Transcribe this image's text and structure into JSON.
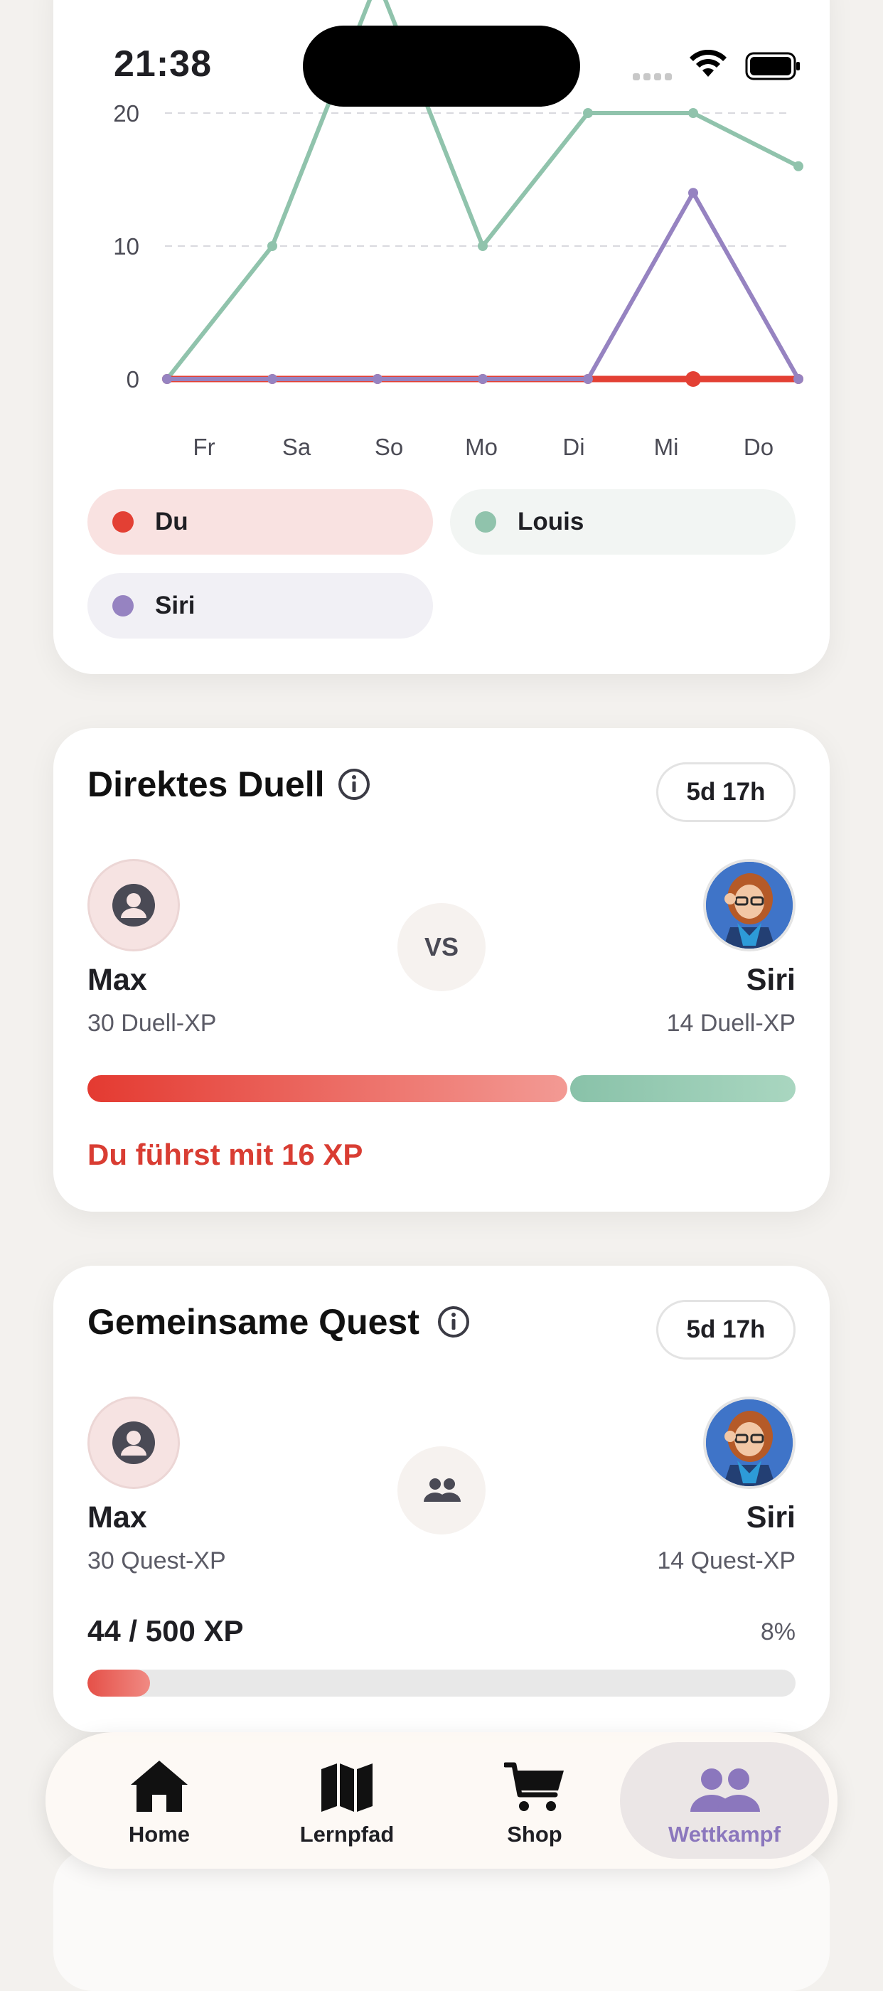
{
  "status_bar": {
    "time": "21:38"
  },
  "chart_card": {
    "chart_data": {
      "type": "line",
      "categories": [
        "Fr",
        "Sa",
        "So",
        "Mo",
        "Di",
        "Mi",
        "Do"
      ],
      "y_ticks": [
        "0",
        "10",
        "20"
      ],
      "ylim": [
        0,
        20
      ],
      "grid": true,
      "series": [
        {
          "name": "Du",
          "color": "#e34034",
          "values": [
            0,
            0,
            0,
            0,
            0,
            0,
            0
          ],
          "x_offsets": [
            0,
            1,
            2,
            3,
            4,
            5,
            6
          ]
        },
        {
          "name": "Louis",
          "color": "#90c3ac",
          "values": [
            0,
            10,
            30,
            10,
            20,
            20,
            16
          ]
        },
        {
          "name": "Siri",
          "color": "#9683c1",
          "values": [
            0,
            0,
            0,
            0,
            0,
            14,
            0
          ]
        }
      ]
    },
    "legend": [
      {
        "label": "Du",
        "color": "#e34034",
        "bg": "#f9e2e1"
      },
      {
        "label": "Louis",
        "color": "#90c3ac",
        "bg": "#f2f5f3"
      },
      {
        "label": "Siri",
        "color": "#9683c1",
        "bg": "#f1f0f5"
      }
    ]
  },
  "duel": {
    "title": "Direktes Duell",
    "timer": "5d 17h",
    "vs_label": "VS",
    "left": {
      "name": "Max",
      "xp": "30 Duell-XP"
    },
    "right": {
      "name": "Siri",
      "xp": "14 Duell-XP"
    },
    "lead_text": "Du führst mit 16 XP",
    "share_left": 0.68
  },
  "quest": {
    "title": "Gemeinsame Quest",
    "timer": "5d 17h",
    "left": {
      "name": "Max",
      "xp": "30 Quest-XP"
    },
    "right": {
      "name": "Siri",
      "xp": "14 Quest-XP"
    },
    "progress_label": "44 / 500 XP",
    "progress_pct": "8%",
    "progress_value": 0.088
  },
  "bottom_nav": {
    "items": [
      {
        "label": "Home",
        "icon": "home-icon",
        "active": false
      },
      {
        "label": "Lernpfad",
        "icon": "map-icon",
        "active": false
      },
      {
        "label": "Shop",
        "icon": "cart-icon",
        "active": false
      },
      {
        "label": "Wettkampf",
        "icon": "people-icon",
        "active": true
      }
    ],
    "active_color": "#8b77bd"
  }
}
